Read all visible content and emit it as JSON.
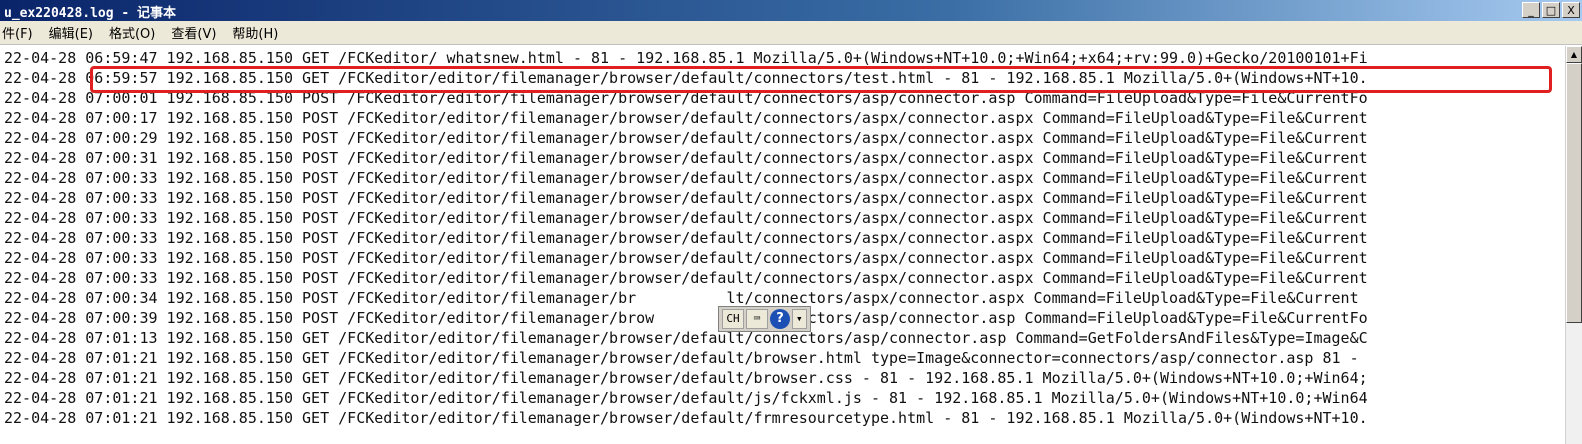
{
  "window": {
    "title": "u_ex220428.log - 记事本",
    "controls": {
      "minimize": "_",
      "maximize": "□",
      "close": "X"
    }
  },
  "menu": {
    "items": [
      {
        "label": "件(F)"
      },
      {
        "label": "编辑(E)"
      },
      {
        "label": "格式(O)"
      },
      {
        "label": "查看(V)"
      },
      {
        "label": "帮助(H)"
      }
    ]
  },
  "log": {
    "lines": [
      "22-04-28 06:59:47 192.168.85.150 GET /FCKeditor/_whatsnew.html - 81 - 192.168.85.1 Mozilla/5.0+(Windows+NT+10.0;+Win64;+x64;+rv:99.0)+Gecko/20100101+Fi",
      "22-04-28 06:59:57 192.168.85.150 GET /FCKeditor/editor/filemanager/browser/default/connectors/test.html - 81 - 192.168.85.1 Mozilla/5.0+(Windows+NT+10.",
      "22-04-28 07:00:01 192.168.85.150 POST /FCKeditor/editor/filemanager/browser/default/connectors/asp/connector.asp Command=FileUpload&Type=File&CurrentFo",
      "22-04-28 07:00:17 192.168.85.150 POST /FCKeditor/editor/filemanager/browser/default/connectors/aspx/connector.aspx Command=FileUpload&Type=File&Current",
      "22-04-28 07:00:29 192.168.85.150 POST /FCKeditor/editor/filemanager/browser/default/connectors/aspx/connector.aspx Command=FileUpload&Type=File&Current",
      "22-04-28 07:00:31 192.168.85.150 POST /FCKeditor/editor/filemanager/browser/default/connectors/aspx/connector.aspx Command=FileUpload&Type=File&Current",
      "22-04-28 07:00:33 192.168.85.150 POST /FCKeditor/editor/filemanager/browser/default/connectors/aspx/connector.aspx Command=FileUpload&Type=File&Current",
      "22-04-28 07:00:33 192.168.85.150 POST /FCKeditor/editor/filemanager/browser/default/connectors/aspx/connector.aspx Command=FileUpload&Type=File&Current",
      "22-04-28 07:00:33 192.168.85.150 POST /FCKeditor/editor/filemanager/browser/default/connectors/aspx/connector.aspx Command=FileUpload&Type=File&Current",
      "22-04-28 07:00:33 192.168.85.150 POST /FCKeditor/editor/filemanager/browser/default/connectors/aspx/connector.aspx Command=FileUpload&Type=File&Current",
      "22-04-28 07:00:33 192.168.85.150 POST /FCKeditor/editor/filemanager/browser/default/connectors/aspx/connector.aspx Command=FileUpload&Type=File&Current",
      "22-04-28 07:00:33 192.168.85.150 POST /FCKeditor/editor/filemanager/browser/default/connectors/aspx/connector.aspx Command=FileUpload&Type=File&Current",
      "22-04-28 07:00:34 192.168.85.150 POST /FCKeditor/editor/filemanager/br          lt/connectors/aspx/connector.aspx Command=FileUpload&Type=File&Current",
      "22-04-28 07:00:39 192.168.85.150 POST /FCKeditor/editor/filemanager/brow        ult/connectors/asp/connector.asp Command=FileUpload&Type=File&CurrentFo",
      "22-04-28 07:01:13 192.168.85.150 GET /FCKeditor/editor/filemanager/browser/default/connectors/asp/connector.asp Command=GetFoldersAndFiles&Type=Image&C",
      "22-04-28 07:01:21 192.168.85.150 GET /FCKeditor/editor/filemanager/browser/default/browser.html type=Image&connector=connectors/asp/connector.asp 81 -",
      "22-04-28 07:01:21 192.168.85.150 GET /FCKeditor/editor/filemanager/browser/default/browser.css - 81 - 192.168.85.1 Mozilla/5.0+(Windows+NT+10.0;+Win64;",
      "22-04-28 07:01:21 192.168.85.150 GET /FCKeditor/editor/filemanager/browser/default/js/fckxml.js - 81 - 192.168.85.1 Mozilla/5.0+(Windows+NT+10.0;+Win64",
      "22-04-28 07:01:21 192.168.85.150 GET /FCKeditor/editor/filemanager/browser/default/frmresourcetype.html - 81 - 192.168.85.1 Mozilla/5.0+(Windows+NT+10."
    ]
  },
  "ime_toolbar": {
    "lang": "CH",
    "keyboard_glyph": "⌨",
    "help_glyph": "?",
    "menu_glyph": "▾"
  },
  "colors": {
    "highlight_border": "#e02020",
    "titlebar_start": "#0a246a"
  }
}
